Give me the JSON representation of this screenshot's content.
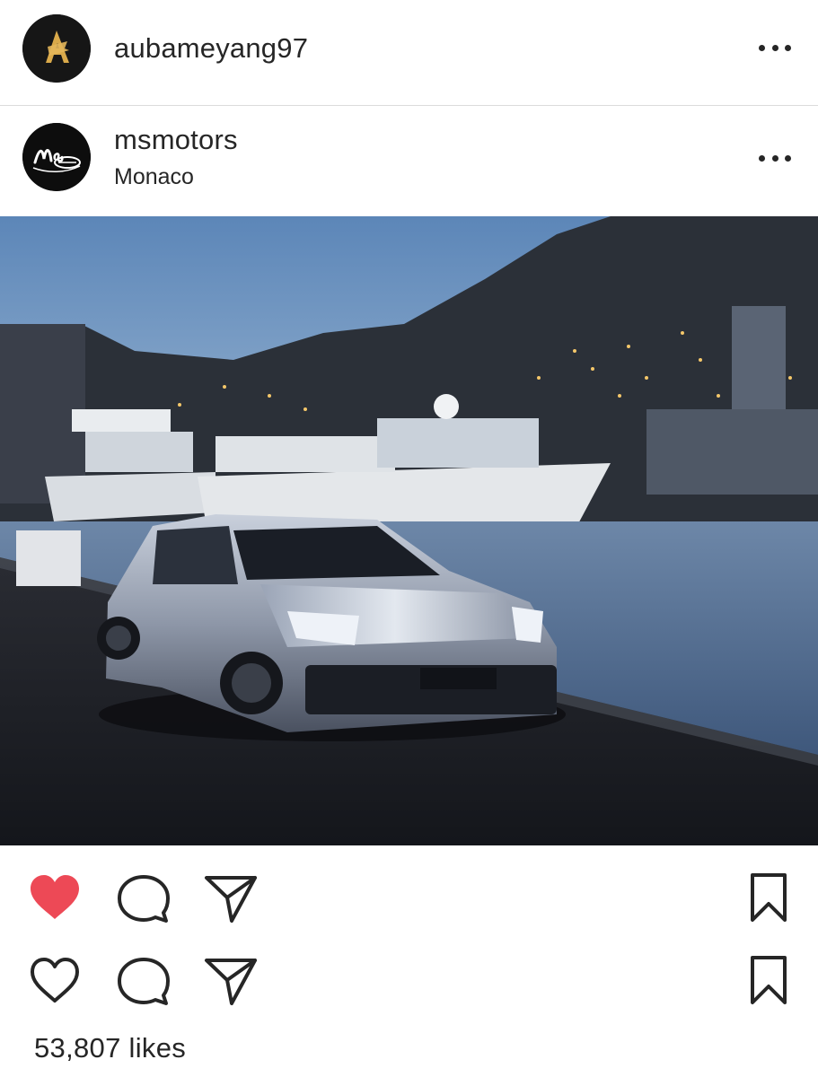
{
  "top_header": {
    "username": "aubameyang97",
    "avatar_icon": "gold-a-logo-icon"
  },
  "post": {
    "username": "msmotors",
    "location": "Monaco",
    "avatar_icon": "ms-motors-logo-icon",
    "image_description_icon": "car-harbor-photo"
  },
  "actions": {
    "row1": {
      "like_icon": "heart-filled-icon",
      "comment_icon": "comment-icon",
      "share_icon": "paper-plane-icon",
      "save_icon": "bookmark-icon",
      "liked": true
    },
    "row2": {
      "like_icon": "heart-outline-icon",
      "comment_icon": "comment-icon",
      "share_icon": "paper-plane-icon",
      "save_icon": "bookmark-icon",
      "liked": false
    }
  },
  "likes_text": "53,807 likes",
  "colors": {
    "like_red": "#ed4956",
    "text": "#262626",
    "divider": "#dbdbdb"
  }
}
